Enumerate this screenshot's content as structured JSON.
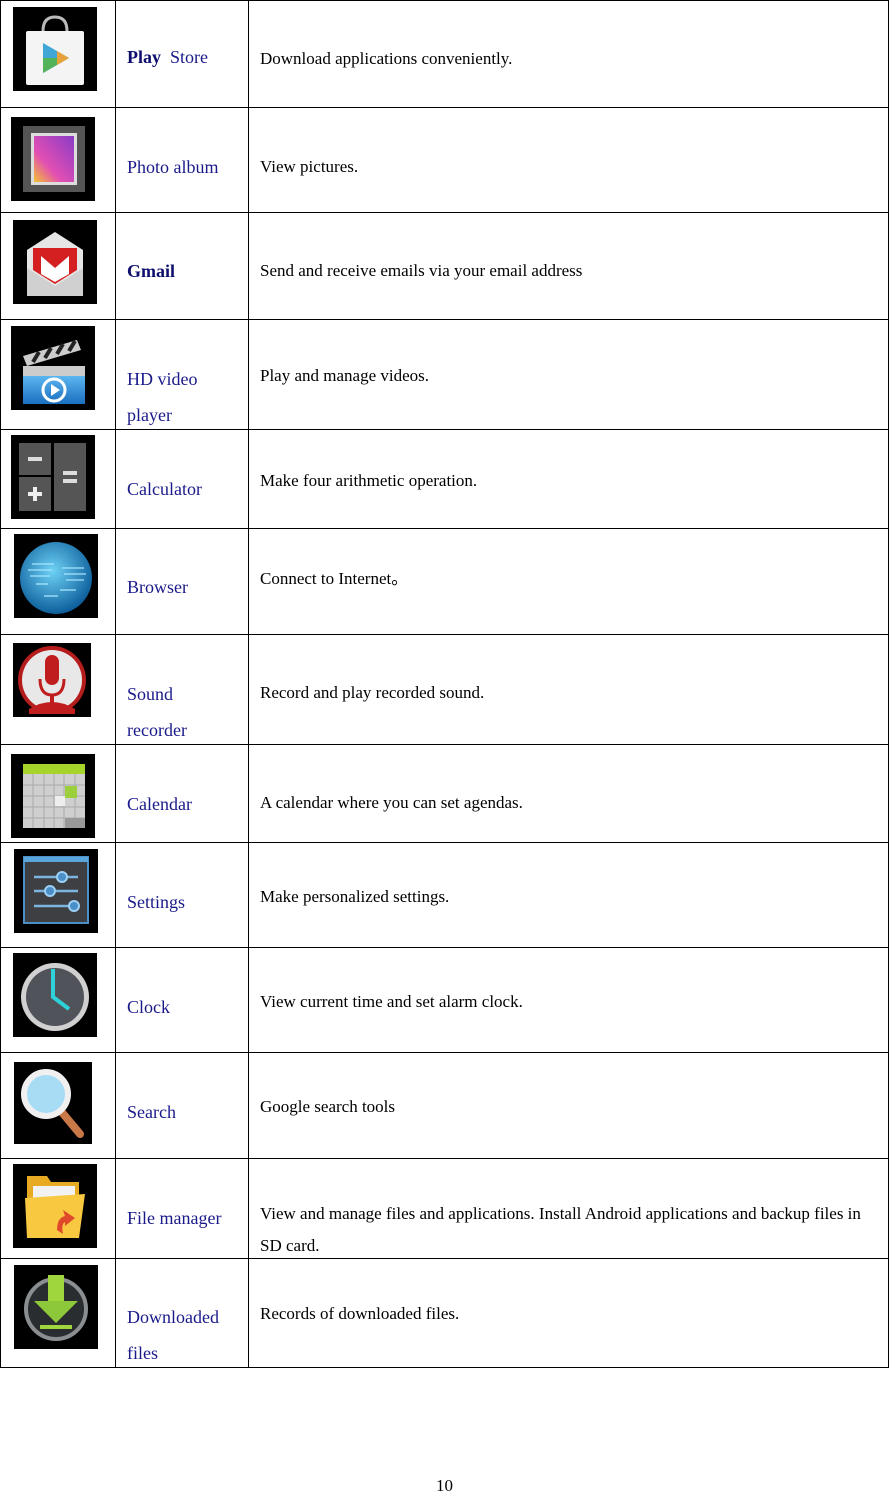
{
  "table": {
    "rows": [
      {
        "icon": "play-store-icon",
        "name": "Play",
        "name_suffix": "Store",
        "description": "Download applications conveniently."
      },
      {
        "icon": "photo-album-icon",
        "name": "Photo album",
        "description": "View pictures."
      },
      {
        "icon": "gmail-icon",
        "name": "Gmail",
        "description": "Send and receive emails via your email address"
      },
      {
        "icon": "video-player-icon",
        "name": "HD video player",
        "description": "Play and manage videos."
      },
      {
        "icon": "calculator-icon",
        "name": "Calculator",
        "description": "Make four arithmetic operation."
      },
      {
        "icon": "browser-globe-icon",
        "name": "Browser",
        "description": "Connect to Internet。"
      },
      {
        "icon": "microphone-icon",
        "name": "Sound recorder",
        "description": "Record and play recorded sound."
      },
      {
        "icon": "calendar-icon",
        "name": "Calendar",
        "description": "A calendar where you can set agendas."
      },
      {
        "icon": "settings-sliders-icon",
        "name": "Settings",
        "description": "Make personalized settings."
      },
      {
        "icon": "clock-icon",
        "name": "Clock",
        "description": "View current time and set alarm clock."
      },
      {
        "icon": "magnifier-search-icon",
        "name": "Search",
        "description": "Google search tools"
      },
      {
        "icon": "folder-icon",
        "name": "File manager",
        "description": "View and manage files and applications. Install Android applications and backup files in SD card."
      },
      {
        "icon": "download-icon",
        "name": "Downloaded files",
        "description": "Records of downloaded files."
      }
    ]
  },
  "page_number": "10",
  "colors": {
    "app_name": "#1a1a8a",
    "text": "#000000"
  }
}
